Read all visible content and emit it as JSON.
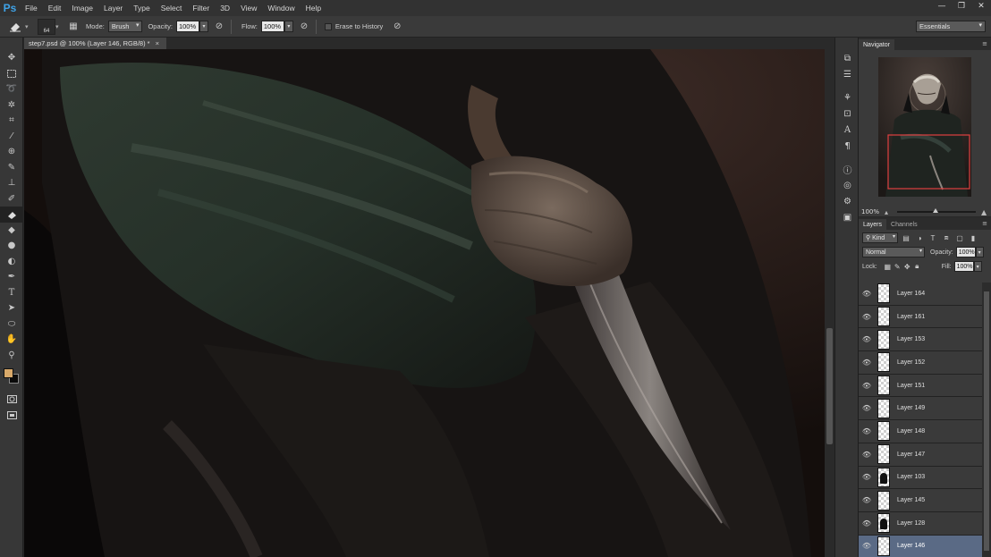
{
  "menubar": {
    "logo": "Ps",
    "items": [
      "File",
      "Edit",
      "Image",
      "Layer",
      "Type",
      "Select",
      "Filter",
      "3D",
      "View",
      "Window",
      "Help"
    ],
    "win_controls": [
      "—",
      "❐",
      "✕"
    ]
  },
  "options": {
    "brush_size": "64",
    "mode_label": "Mode:",
    "mode_value": "Brush",
    "opacity_label": "Opacity:",
    "opacity_value": "100%",
    "flow_label": "Flow:",
    "flow_value": "100%",
    "erase_history_label": "Erase to History",
    "workspace": "Essentials"
  },
  "document": {
    "tab_title": "step7.psd @ 100% (Layer 146, RGB/8) *",
    "close": "×"
  },
  "colors": {
    "foreground": "#d8a96a",
    "background": "#0a0a0a",
    "selection_layer": "#5a6a85",
    "navigator_view_box": "#e04040"
  },
  "navigator": {
    "tab": "Navigator",
    "zoom": "100%"
  },
  "layers": {
    "tabs": [
      "Layers",
      "Channels"
    ],
    "filter_kind": "Kind",
    "blend_mode": "Normal",
    "opacity_label": "Opacity:",
    "opacity_value": "100%",
    "lock_label": "Lock:",
    "fill_label": "Fill:",
    "fill_value": "100%",
    "list": [
      {
        "name": "Layer 164",
        "thumb": "transparent"
      },
      {
        "name": "Layer 161",
        "thumb": "transparent"
      },
      {
        "name": "Layer 153",
        "thumb": "transparent"
      },
      {
        "name": "Layer 152",
        "thumb": "transparent"
      },
      {
        "name": "Layer 151",
        "thumb": "transparent"
      },
      {
        "name": "Layer 149",
        "thumb": "transparent"
      },
      {
        "name": "Layer 148",
        "thumb": "transparent"
      },
      {
        "name": "Layer 147",
        "thumb": "transparent"
      },
      {
        "name": "Layer 103",
        "thumb": "art"
      },
      {
        "name": "Layer 145",
        "thumb": "transparent"
      },
      {
        "name": "Layer 128",
        "thumb": "art"
      },
      {
        "name": "Layer 146",
        "thumb": "transparent",
        "selected": true
      }
    ]
  },
  "icons": {
    "toolbar": [
      "move-icon",
      "marquee-icon",
      "lasso-icon",
      "magic-wand-icon",
      "crop-icon",
      "eyedropper-icon",
      "healing-brush-icon",
      "brush-icon",
      "clone-stamp-icon",
      "history-brush-icon",
      "eraser-icon",
      "paint-bucket-icon",
      "blur-icon",
      "dodge-icon",
      "pen-icon",
      "type-icon",
      "path-selection-icon",
      "ellipse-shape-icon",
      "hand-icon",
      "zoom-icon"
    ],
    "strip": [
      "history-icon",
      "adjust-icon",
      "brush-presets-icon",
      "paragraph-styles-icon",
      "character-icon",
      "paragraph-icon",
      "info-icon",
      "color-icon",
      "styles-icon",
      "adjustments-icon"
    ]
  }
}
